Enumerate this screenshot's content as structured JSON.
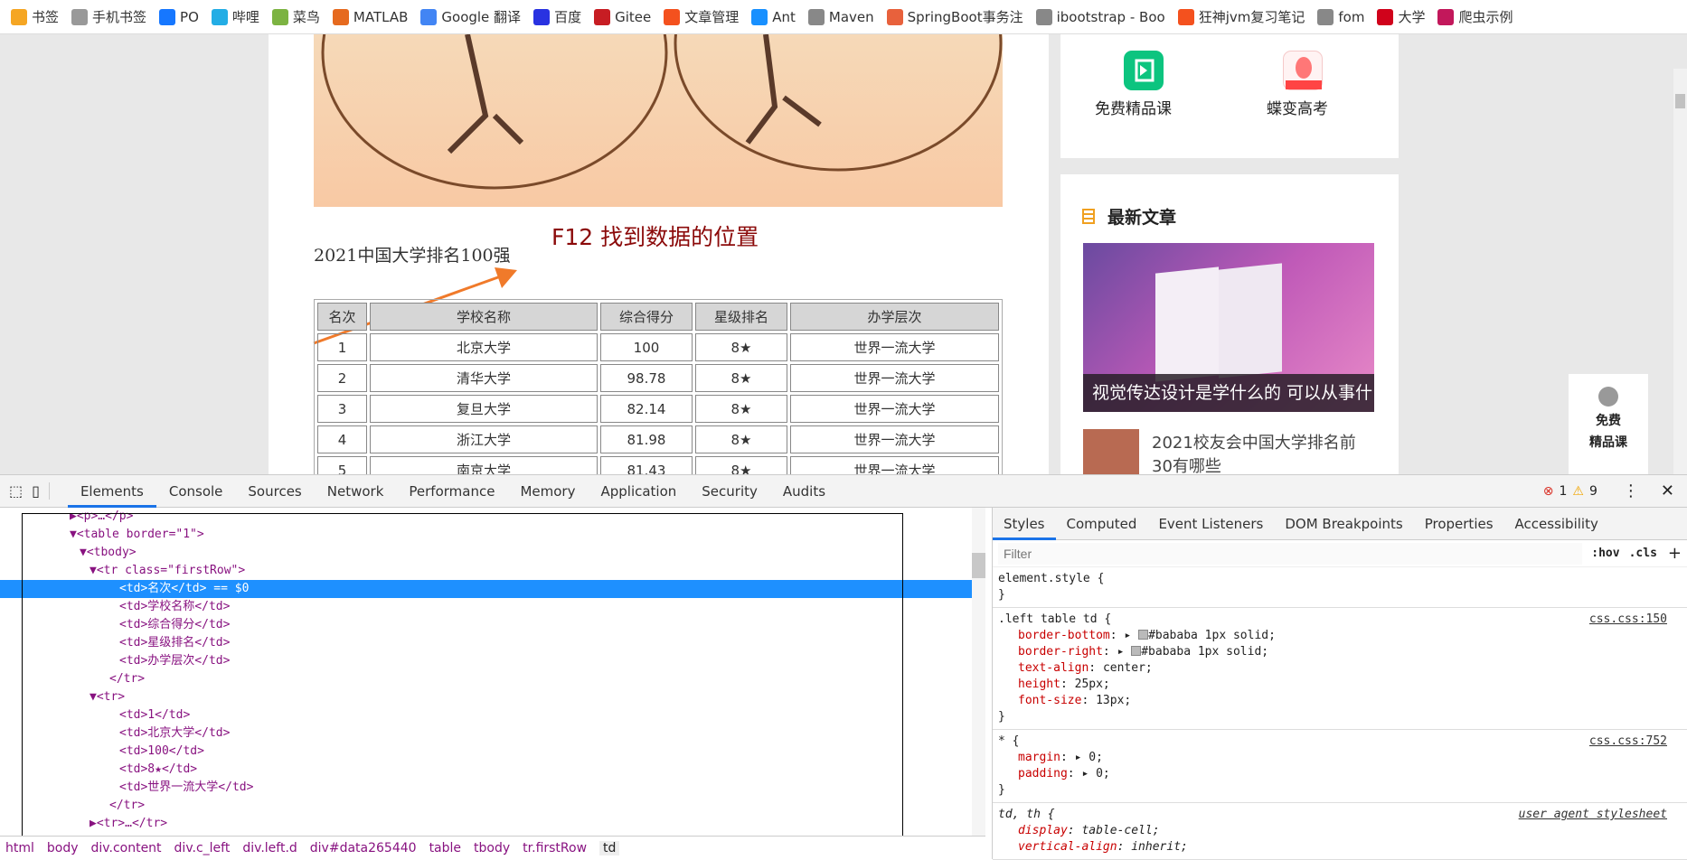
{
  "bookmarks": [
    {
      "label": "书签",
      "icon": "star-icon",
      "color": "#f5a623"
    },
    {
      "label": "手机书签",
      "icon": "phone-icon",
      "color": "#999"
    },
    {
      "label": "PO",
      "icon": "on-icon",
      "color": "#1677ff"
    },
    {
      "label": "哔哩",
      "icon": "bilibili-icon",
      "color": "#23ade5"
    },
    {
      "label": "菜鸟",
      "icon": "runoob-icon",
      "color": "#7cb342"
    },
    {
      "label": "MATLAB",
      "icon": "matlab-icon",
      "color": "#e66a1f"
    },
    {
      "label": "Google 翻译",
      "icon": "translate-icon",
      "color": "#4285f4"
    },
    {
      "label": "百度",
      "icon": "baidu-icon",
      "color": "#2932e1"
    },
    {
      "label": "Gitee",
      "icon": "gitee-icon",
      "color": "#c71d23"
    },
    {
      "label": "文章管理",
      "icon": "csdn-icon",
      "color": "#f4511e"
    },
    {
      "label": "Ant",
      "icon": "ant-icon",
      "color": "#1890ff"
    },
    {
      "label": "Maven",
      "icon": "globe-icon",
      "color": "#888"
    },
    {
      "label": "SpringBoot事务注",
      "icon": "jian-icon",
      "color": "#e8613c"
    },
    {
      "label": "ibootstrap - Boo",
      "icon": "globe-icon",
      "color": "#888"
    },
    {
      "label": "狂神jvm复习笔记",
      "icon": "csdn-icon",
      "color": "#f4511e"
    },
    {
      "label": "fom",
      "icon": "globe-icon",
      "color": "#888"
    },
    {
      "label": "大学",
      "icon": "univ-icon",
      "color": "#d0021b"
    },
    {
      "label": "爬虫示例",
      "icon": "spider-icon",
      "color": "#c2185b"
    }
  ],
  "main": {
    "title": "2021中国大学排名100强",
    "annotation": "F12 找到数据的位置",
    "table": {
      "headers": [
        "名次",
        "学校名称",
        "综合得分",
        "星级排名",
        "办学层次"
      ],
      "rows": [
        [
          "1",
          "北京大学",
          "100",
          "8★",
          "世界一流大学"
        ],
        [
          "2",
          "清华大学",
          "98.78",
          "8★",
          "世界一流大学"
        ],
        [
          "3",
          "复旦大学",
          "82.14",
          "8★",
          "世界一流大学"
        ],
        [
          "4",
          "浙江大学",
          "81.98",
          "8★",
          "世界一流大学"
        ],
        [
          "5",
          "南京大学",
          "81.43",
          "8★",
          "世界一流大学"
        ]
      ]
    }
  },
  "sidebar": {
    "apps": [
      "免费精品课",
      "蝶变高考"
    ],
    "latest_title": "最新文章",
    "featured_caption": "视觉传达设计是学什么的 可以从事什",
    "article": "2021校友会中国大学排名前30有哪些",
    "float": [
      "免费",
      "精品课"
    ]
  },
  "devtools": {
    "tabs": [
      "Elements",
      "Console",
      "Sources",
      "Network",
      "Performance",
      "Memory",
      "Application",
      "Security",
      "Audits"
    ],
    "errors": "1",
    "warnings": "9",
    "tree": [
      "<p>…</p>",
      "<table border=\"1\">",
      "<tbody>",
      "<tr class=\"firstRow\">",
      "<td>名次</td> == $0",
      "<td>学校名称</td>",
      "<td>综合得分</td>",
      "<td>星级排名</td>",
      "<td>办学层次</td>",
      "</tr>",
      "<tr>",
      "<td>1</td>",
      "<td>北京大学</td>",
      "<td>100</td>",
      "<td>8★</td>",
      "<td>世界一流大学</td>",
      "</tr>",
      "<tr>…</tr>"
    ],
    "breadcrumb": [
      "html",
      "body",
      "div.content",
      "div.c_left",
      "div.left.d",
      "div#data265440",
      "table",
      "tbody",
      "tr.firstRow",
      "td"
    ],
    "style_tabs": [
      "Styles",
      "Computed",
      "Event Listeners",
      "DOM Breakpoints",
      "Properties",
      "Accessibility"
    ],
    "filter_placeholder": "Filter",
    "hov": ":hov",
    "cls": ".cls",
    "rules": [
      {
        "selector": "element.style {",
        "props": [],
        "source": ""
      },
      {
        "selector": ".left table td {",
        "source": "css.css:150",
        "props": [
          [
            "border-bottom",
            ": ▸ ",
            "#bababa 1px solid;",
            true
          ],
          [
            "border-right",
            ": ▸ ",
            "#bababa 1px solid;",
            true
          ],
          [
            "text-align",
            ": ",
            "center;",
            false
          ],
          [
            "height",
            ": ",
            "25px;",
            false
          ],
          [
            "font-size",
            ": ",
            "13px;",
            false
          ]
        ]
      },
      {
        "selector": "* {",
        "source": "css.css:752",
        "props": [
          [
            "margin",
            ": ▸ ",
            "0;",
            false
          ],
          [
            "padding",
            ": ▸ ",
            "0;",
            false
          ]
        ]
      },
      {
        "selector": "td, th {",
        "source": "user agent stylesheet",
        "props": [
          [
            "display",
            ": ",
            "table-cell;",
            false
          ],
          [
            "vertical-align",
            ": ",
            "inherit;",
            false
          ]
        ]
      }
    ]
  }
}
